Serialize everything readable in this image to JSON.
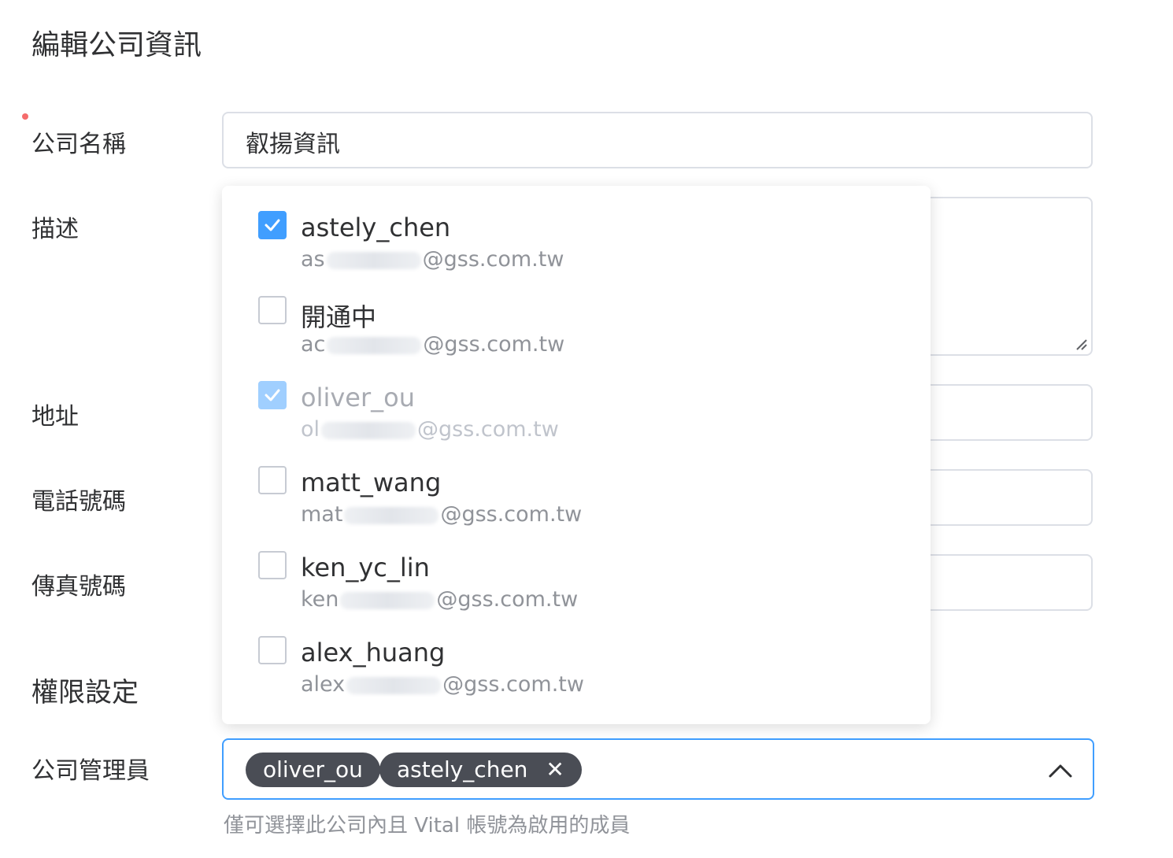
{
  "title": "編輯公司資訊",
  "form": {
    "company_name": {
      "label": "公司名稱",
      "value": "叡揚資訊"
    },
    "description": {
      "label": "描述"
    },
    "address": {
      "label": "地址"
    },
    "phone": {
      "label": "電話號碼"
    },
    "fax": {
      "label": "傳真號碼"
    },
    "permissions": {
      "label": "權限設定"
    },
    "admins": {
      "label": "公司管理員",
      "tags": [
        "oliver_ou",
        "astely_chen"
      ],
      "hint": "僅可選擇此公司內且 Vital 帳號為啟用的成員"
    }
  },
  "dropdown": {
    "options": [
      {
        "name": "astely_chen",
        "email_prefix": "as",
        "email_domain": "@gss.com.tw",
        "checked": true,
        "disabled": false
      },
      {
        "name": "開通中",
        "email_prefix": "ac",
        "email_domain": "@gss.com.tw",
        "checked": false,
        "disabled": false
      },
      {
        "name": "oliver_ou",
        "email_prefix": "ol",
        "email_domain": "@gss.com.tw",
        "checked": true,
        "disabled": true
      },
      {
        "name": "matt_wang",
        "email_prefix": "mat",
        "email_domain": "@gss.com.tw",
        "checked": false,
        "disabled": false
      },
      {
        "name": "ken_yc_lin",
        "email_prefix": "ken",
        "email_domain": "@gss.com.tw",
        "checked": false,
        "disabled": false
      },
      {
        "name": "alex_huang",
        "email_prefix": "alex",
        "email_domain": "@gss.com.tw",
        "checked": false,
        "disabled": false
      }
    ]
  },
  "icons": {
    "tag_close": "✕",
    "chevron": "chevron-up-icon",
    "check": "check-icon"
  },
  "colors": {
    "primary": "#409eff",
    "required": "#f56c6c",
    "tag_bg": "#4a4d55"
  }
}
